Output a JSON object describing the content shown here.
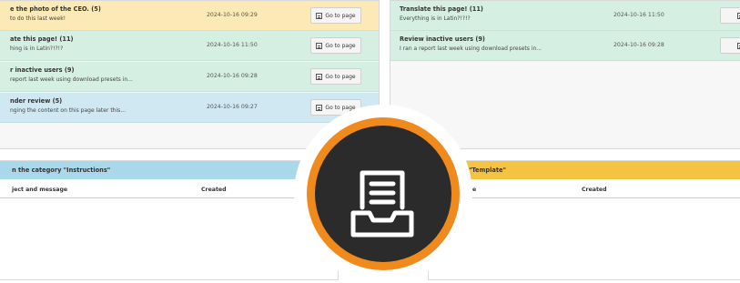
{
  "left_tasks": [
    {
      "title": "e the photo of the CEO. (5)",
      "message": "to do this last week!",
      "date": "2024-10-16 09:29",
      "button": "Go to page",
      "color": "#fbe9b6"
    },
    {
      "title": "ate this page! (11)",
      "message": "hing is in Latin?!?!?",
      "date": "2024-10-16 11:50",
      "button": "Go to page",
      "color": "#d6efe3"
    },
    {
      "title": "r inactive users (9)",
      "message": "report last week using download presets in...",
      "date": "2024-10-16 09:28",
      "button": "Go to page",
      "color": "#d6efe3"
    },
    {
      "title": "nder review (5)",
      "message": "nging the content on this page later this...",
      "date": "2024-10-16 09:27",
      "button": "Go to page",
      "color": "#cfe8f2"
    }
  ],
  "right_tasks": [
    {
      "title": "Translate this page! (11)",
      "message": "Everything is in Latin?!?!?",
      "date": "2024-10-16 11:50",
      "button": "Go",
      "color": "#d6efe3"
    },
    {
      "title": "Review inactive users (9)",
      "message": "I ran a report last week using download presets in...",
      "date": "2024-10-16 09:28",
      "button": "Go",
      "color": "#d6efe3"
    }
  ],
  "instructions": {
    "header": "n the category \"Instructions\"",
    "col_subject": "ject and message",
    "col_created": "Created",
    "color": "#a8d8ea"
  },
  "template": {
    "header": "\"Template\"",
    "col_subject": "e",
    "col_created": "Created",
    "color": "#f5c342"
  },
  "badge": {
    "icon": "document-tray-icon",
    "ring_color": "#f08a1c",
    "fill_color": "#2b2b2b"
  }
}
